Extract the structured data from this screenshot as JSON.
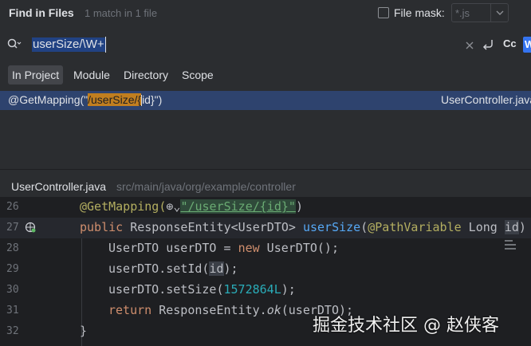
{
  "header": {
    "title": "Find in Files",
    "match_count": "1 match in 1 file",
    "file_mask_label": "File mask:",
    "file_mask_value": "*.js"
  },
  "search": {
    "query": "userSize/\\W+",
    "case_toggle": "Cc",
    "word_toggle": "W"
  },
  "scope_tabs": [
    {
      "label": "In Project",
      "active": true
    },
    {
      "label": "Module",
      "active": false
    },
    {
      "label": "Directory",
      "active": false
    },
    {
      "label": "Scope",
      "active": false
    }
  ],
  "result": {
    "prefix": "@GetMapping(\"",
    "match": "/userSize/{",
    "suffix": "id}\")",
    "file": "UserController.java"
  },
  "preview": {
    "file": "UserController.java",
    "path": "src/main/java/org/example/controller"
  },
  "code_lines": [
    {
      "no": "26"
    },
    {
      "no": "27"
    },
    {
      "no": "28"
    },
    {
      "no": "29"
    },
    {
      "no": "30"
    },
    {
      "no": "31"
    },
    {
      "no": "32"
    }
  ],
  "code": {
    "l26_ann": "@GetMapping(",
    "l26_str": "\"/userSize/{id}\"",
    "l26_end": ")",
    "l27_kw": "public",
    "l27_type": " ResponseEntity<UserDTO> ",
    "l27_fn": "userSize",
    "l27_open": "(",
    "l27_ann": "@PathVariable",
    "l27_rest": " Long ",
    "l27_id": "id",
    "l27_close": ")",
    "l28_a": "UserDTO userDTO = ",
    "l28_kw": "new",
    "l28_b": " UserDTO();",
    "l29_a": "userDTO.setId(",
    "l29_id": "id",
    "l29_b": ");",
    "l30_a": "userDTO.setSize(",
    "l30_num": "1572864L",
    "l30_b": ");",
    "l31_kw": "return",
    "l31_a": " ResponseEntity.",
    "l31_it": "ok",
    "l31_b": "(userDTO);",
    "l32": "}"
  },
  "watermark": "掘金技术社区 @ 赵侠客"
}
